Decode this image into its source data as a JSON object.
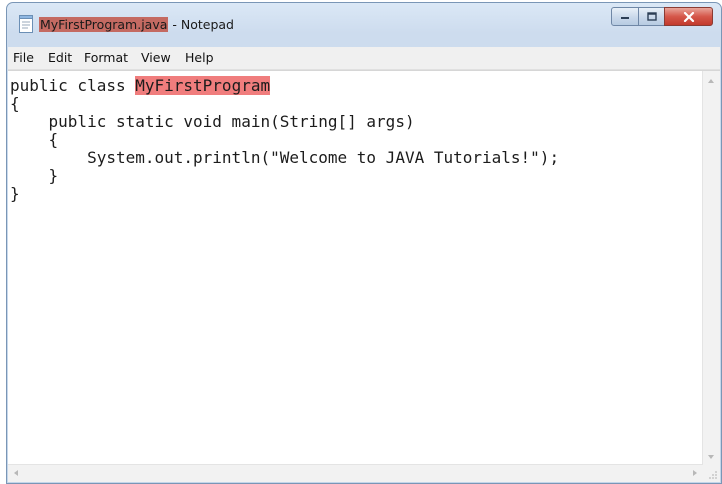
{
  "window": {
    "title_file": "MyFirstProgram.java",
    "title_suffix": " - Notepad",
    "icon": "notepad-icon"
  },
  "caption_buttons": {
    "minimize_icon": "minimize-icon",
    "maximize_icon": "maximize-icon",
    "close_icon": "close-icon"
  },
  "menu": {
    "items": [
      {
        "label": "File"
      },
      {
        "label": "Edit"
      },
      {
        "label": "Format"
      },
      {
        "label": "View"
      },
      {
        "label": "Help"
      }
    ]
  },
  "editor": {
    "lines": [
      {
        "before": "public class ",
        "selected": "MyFirstProgram",
        "after": ""
      },
      {
        "text": "{"
      },
      {
        "text": "    public static void main(String[] args)"
      },
      {
        "text": "    {"
      },
      {
        "text": "        System.out.println(\"Welcome to JAVA Tutorials!\");"
      },
      {
        "text": "    }"
      },
      {
        "text": "}"
      }
    ]
  },
  "colors": {
    "selection": "#f07d7d",
    "title_highlight": "#c46a62",
    "close_button": "#c23a2c"
  }
}
